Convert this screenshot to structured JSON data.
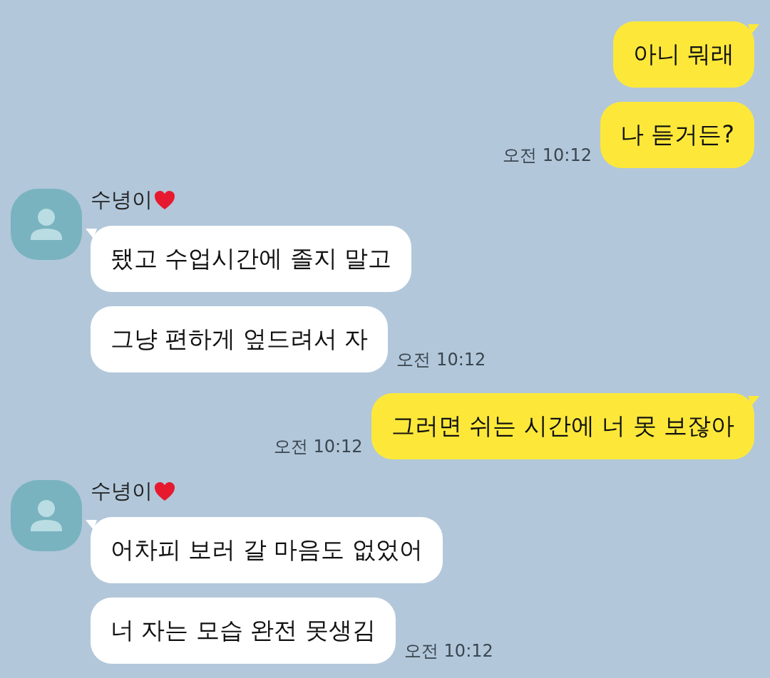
{
  "messages": [
    {
      "kind": "outgoing",
      "bubbles": [
        "아니 뭐래",
        "나 듣거든?"
      ],
      "time": "오전 10:12"
    },
    {
      "kind": "incoming",
      "sender": "수녕이",
      "bubbles": [
        "됐고 수업시간에 졸지 말고",
        "그냥 편하게 엎드려서 자"
      ],
      "time": "오전 10:12"
    },
    {
      "kind": "outgoing",
      "bubbles": [
        "그러면 쉬는 시간에 너 못 보잖아"
      ],
      "time": "오전 10:12"
    },
    {
      "kind": "incoming",
      "sender": "수녕이",
      "bubbles": [
        "어차피 보러 갈 마음도 없었어",
        "너 자는 모습 완전 못생김"
      ],
      "time": "오전 10:12"
    }
  ]
}
